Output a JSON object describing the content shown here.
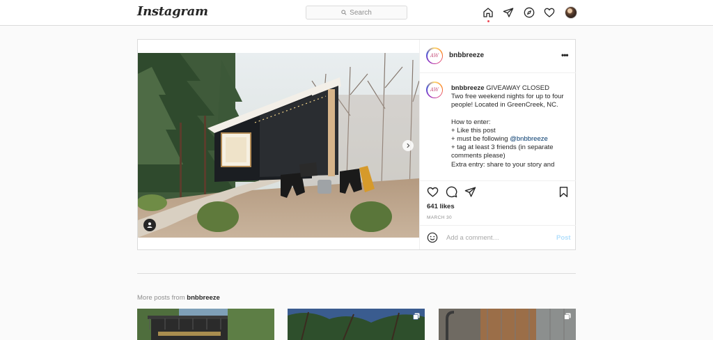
{
  "nav": {
    "logo": "Instagram",
    "search_placeholder": "Search",
    "icons": [
      "home-icon",
      "direct-icon",
      "explore-icon",
      "activity-heart-icon",
      "profile-avatar"
    ]
  },
  "post": {
    "username": "bnbbreeze",
    "avatar_monogram": "AW",
    "caption_username": "bnbbreeze",
    "caption_lines": [
      "GIVEAWAY CLOSED",
      "Two free weekend nights for up to four people! Located in GreenCreek, NC.",
      "",
      "How to enter:",
      "+ Like this post",
      "+ must be following ",
      "+ tag at least 3 friends (in separate comments please)",
      "Extra entry: share to your story and"
    ],
    "mention": "@bnbbreeze",
    "likes": "641 likes",
    "date": "MARCH 30",
    "comment_placeholder": "Add a comment…",
    "post_button": "Post",
    "more_button": "•••"
  },
  "more_posts": {
    "prefix": "More posts from ",
    "username": "bnbbreeze"
  },
  "colors": {
    "accent_blue_disabled": "#b2dffc",
    "notification_dot": "#ed4956",
    "mention": "#00376b"
  }
}
